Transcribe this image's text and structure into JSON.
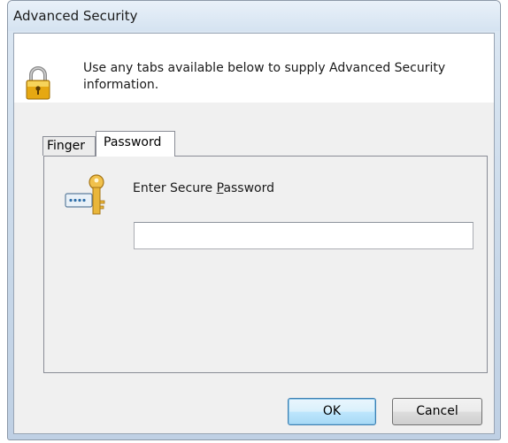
{
  "window": {
    "title": "Advanced Security"
  },
  "header": {
    "message": "Use any tabs available below to supply Advanced Security information.",
    "icon": "padlock-icon"
  },
  "tabs": [
    {
      "label": "Finger",
      "selected": false
    },
    {
      "label": "Password",
      "selected": true
    }
  ],
  "password_tab": {
    "icon": "key-icon",
    "label_before": "Enter Secure ",
    "label_mnemonic": "P",
    "label_after": "assword",
    "input_value": ""
  },
  "buttons": {
    "ok_label": "OK",
    "cancel_label": "Cancel"
  },
  "colors": {
    "accent": "#3c7fb1",
    "frame": "#c8d8e9"
  }
}
